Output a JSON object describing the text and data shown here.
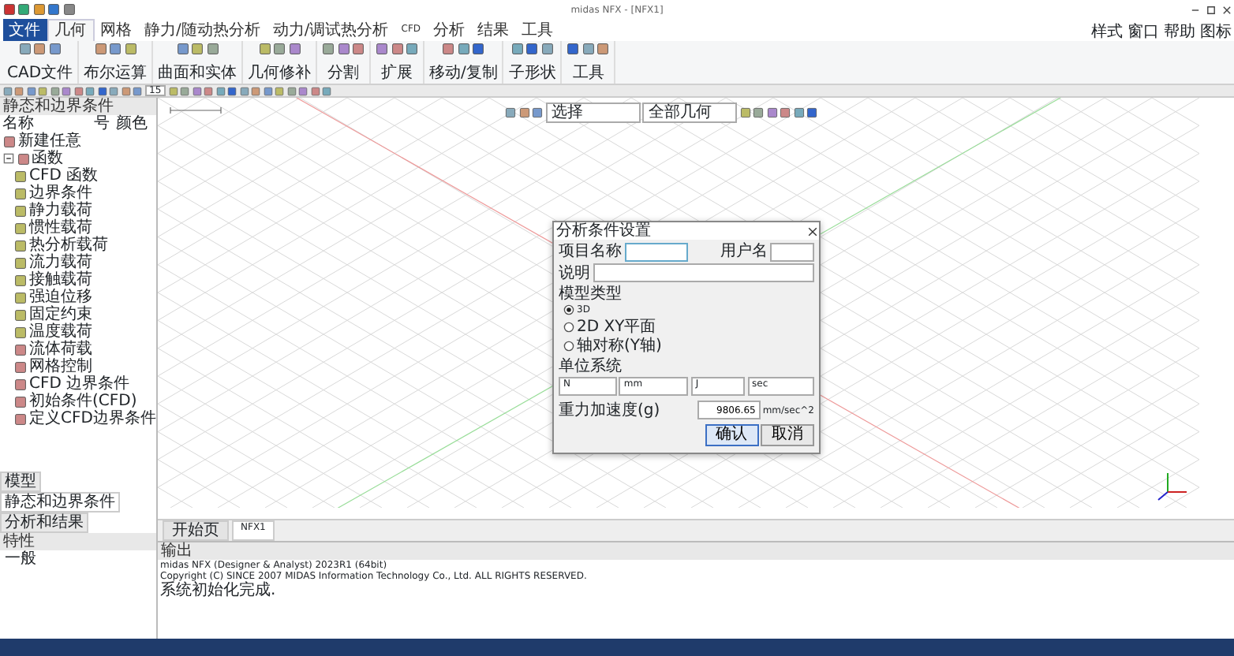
{
  "window": {
    "title": "midas NFX - [NFX1]"
  },
  "ribbon": {
    "tabs": [
      {
        "label": "文件",
        "selected": false,
        "kind": "file"
      },
      {
        "label": "几何",
        "selected": true,
        "kind": "tab"
      },
      {
        "label": "网格",
        "selected": false,
        "kind": "tab"
      },
      {
        "label": "静力/随动热分析",
        "selected": false,
        "kind": "tab"
      },
      {
        "label": "动力/调试热分析",
        "selected": false,
        "kind": "tab"
      },
      {
        "label": "CFD",
        "selected": false,
        "kind": "tab"
      },
      {
        "label": "分析",
        "selected": false,
        "kind": "tab"
      },
      {
        "label": "结果",
        "selected": false,
        "kind": "tab"
      },
      {
        "label": "工具",
        "selected": false,
        "kind": "tab"
      }
    ],
    "groups": [
      "CAD文件",
      "布尔运算",
      "曲面和实体",
      "几何修补",
      "分割",
      "扩展",
      "移动/复制",
      "子形状",
      "工具"
    ],
    "menu_right": [
      "样式",
      "窗口",
      "帮助",
      "图标"
    ]
  },
  "toolbar": {
    "zoom": "15"
  },
  "canvas_toolbar": {
    "fields": [
      "选择",
      "全部几何"
    ]
  },
  "left_panel": {
    "title": "静态和边界条件",
    "columns": [
      "名称",
      "号",
      "颜色"
    ],
    "tree": [
      {
        "label": "新建任意"
      },
      {
        "label": "函数",
        "expanded": true,
        "children": [
          {
            "label": "CFD 函数"
          },
          {
            "label": "边界条件"
          },
          {
            "label": "静力载荷"
          },
          {
            "label": "惯性载荷"
          },
          {
            "label": "热分析载荷"
          },
          {
            "label": "流力载荷"
          },
          {
            "label": "接触载荷"
          },
          {
            "label": "强迫位移"
          },
          {
            "label": "固定约束"
          },
          {
            "label": "温度载荷"
          },
          {
            "label": "流体荷载"
          },
          {
            "label": "网格控制"
          },
          {
            "label": "CFD 边界条件"
          },
          {
            "label": "初始条件(CFD)"
          },
          {
            "label": "定义CFD边界条件"
          }
        ]
      }
    ]
  },
  "left_tabs": [
    {
      "label": "模型",
      "selected": false
    },
    {
      "label": "静态和边界条件",
      "selected": true
    },
    {
      "label": "分析和结果",
      "selected": false
    }
  ],
  "property_panel": {
    "title": "特性",
    "items": [
      "一般"
    ]
  },
  "doc_tabs": [
    {
      "label": "开始页",
      "selected": false
    },
    {
      "label": "NFX1",
      "selected": true
    }
  ],
  "dialog": {
    "title": "分析条件设置",
    "project_label": "项目名称",
    "user_label": "用户名",
    "desc_label": "说明",
    "model_type": {
      "title": "模型类型",
      "options": [
        {
          "label": "3D",
          "selected": true
        },
        {
          "label": "2D XY平面",
          "selected": false
        },
        {
          "label": "轴对称(Y轴)",
          "selected": false
        }
      ]
    },
    "units": {
      "title": "单位系统",
      "values": [
        "N",
        "mm",
        "J",
        "sec"
      ]
    },
    "gravity": {
      "label": "重力加速度(g)",
      "value": "9806.65",
      "unit": "mm/sec^2"
    },
    "buttons": [
      "确认",
      "取消"
    ]
  },
  "output": {
    "title": "输出",
    "lines": [
      "midas NFX (Designer & Analyst) 2023R1 (64bit)",
      "Copyright (C) SINCE 2007 MIDAS Information Technology Co., Ltd. ALL RIGHTS RESERVED.",
      "系统初始化完成."
    ]
  }
}
